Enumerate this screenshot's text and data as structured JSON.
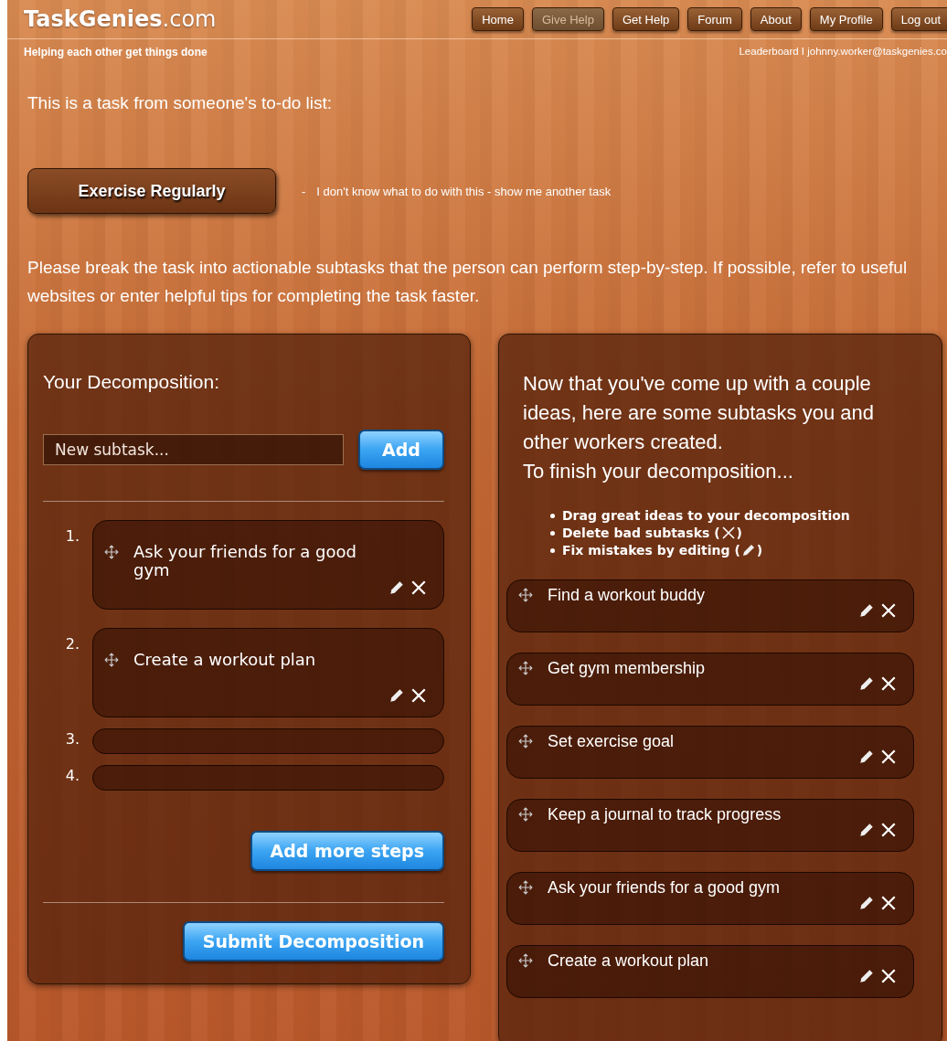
{
  "header": {
    "logo_main": "TaskGenies",
    "logo_suffix": ".com",
    "tagline": "Helping each other get things done",
    "user_links": "Leaderboard I johnny.worker@taskgenies.co"
  },
  "nav": [
    {
      "label": "Home",
      "selected": false
    },
    {
      "label": "Give Help",
      "selected": true
    },
    {
      "label": "Get Help",
      "selected": false
    },
    {
      "label": "Forum",
      "selected": false
    },
    {
      "label": "About",
      "selected": false
    },
    {
      "label": "My Profile",
      "selected": false
    },
    {
      "label": "Log out",
      "selected": false
    }
  ],
  "intro": "This is a task from someone's to-do list:",
  "task": {
    "title": "Exercise Regularly",
    "dash": "-",
    "skip_link": "I don't know what to do with this - show me another task"
  },
  "instructions": "Please break the task into actionable subtasks that the person can perform step-by-step. If possible, refer to useful websites or enter helpful tips for completing the task faster.",
  "decomposition": {
    "title": "Your Decomposition:",
    "new_subtask": {
      "placeholder": "New subtask..."
    },
    "add_button": "Add",
    "steps": [
      {
        "number": "1.",
        "text": "Ask your friends for a good gym"
      },
      {
        "number": "2.",
        "text": "Create a workout plan"
      },
      {
        "number": "3."
      },
      {
        "number": "4."
      }
    ],
    "add_more_button": "Add more steps",
    "submit_button": "Submit Decomposition"
  },
  "suggestions": {
    "intro": "Now that you've come up with a couple ideas, here are some subtasks you and other workers created.",
    "intro_2": "To finish your decomposition...",
    "tips": [
      {
        "text": "Drag great ideas to your decomposition"
      },
      {
        "text": "Delete bad subtasks (",
        "kind": "delete",
        "after": ")"
      },
      {
        "text": "Fix mistakes by editing (",
        "kind": "edit",
        "after": ")"
      }
    ],
    "subtasks": [
      "Find a workout buddy",
      "Get gym membership",
      "Set exercise goal",
      "Keep a journal to track progress",
      "Ask your friends for a good gym",
      "Create a workout plan"
    ]
  }
}
